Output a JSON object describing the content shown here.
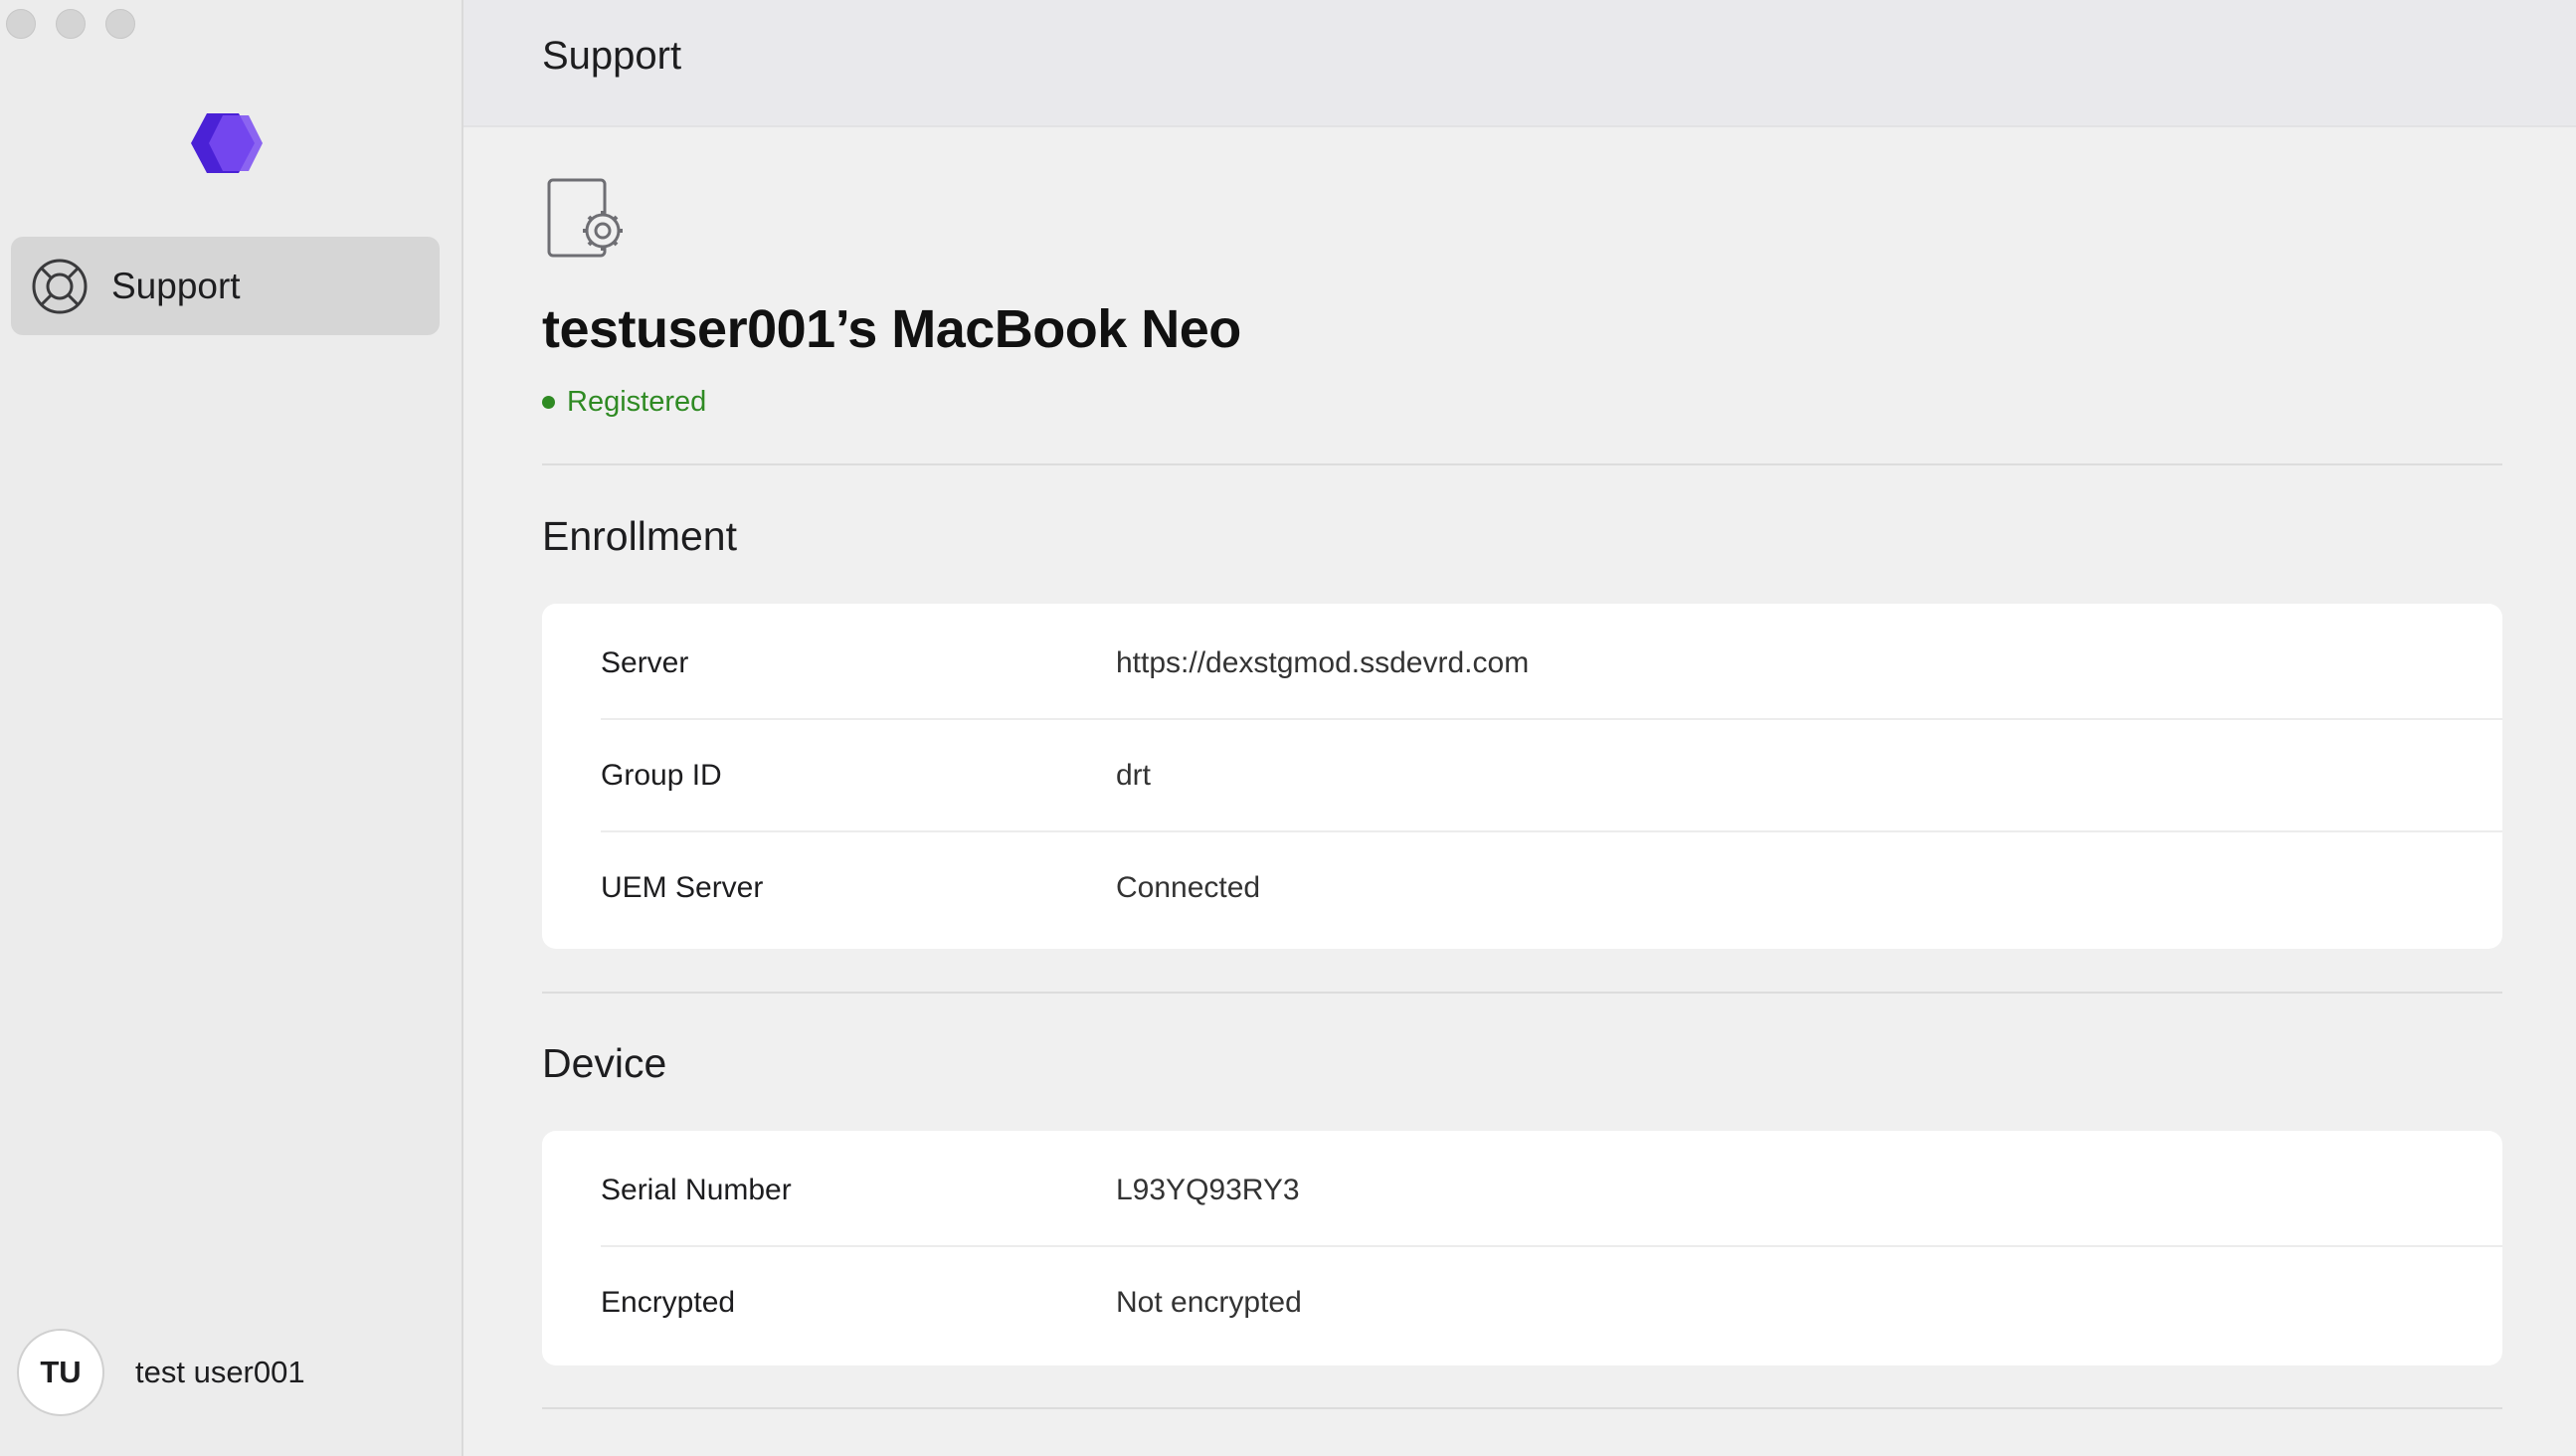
{
  "window": {
    "header_title": "Support"
  },
  "sidebar": {
    "items": [
      {
        "label": "Support",
        "icon": "lifebuoy-icon",
        "selected": true
      }
    ],
    "user": {
      "initials": "TU",
      "name": "test user001"
    }
  },
  "device": {
    "name": "testuser001’s MacBook Neo",
    "status": "Registered",
    "status_color": "#2f8a23"
  },
  "enrollment": {
    "title": "Enrollment",
    "rows": [
      {
        "key": "Server",
        "value": "https://dexstgmod.ssdevrd.com"
      },
      {
        "key": "Group ID",
        "value": "drt"
      },
      {
        "key": "UEM Server",
        "value": "Connected"
      }
    ]
  },
  "device_info": {
    "title": "Device",
    "rows": [
      {
        "key": "Serial Number",
        "value": "L93YQ93RY3"
      },
      {
        "key": "Encrypted",
        "value": "Not encrypted"
      }
    ]
  },
  "colors": {
    "brand": "#5b2ee0",
    "selected_item_bg": "#d6d6d6"
  }
}
